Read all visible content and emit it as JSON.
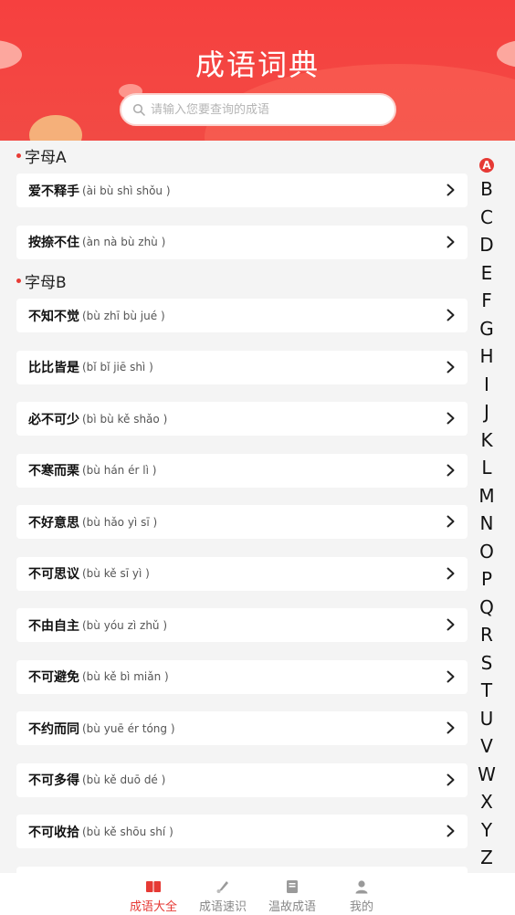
{
  "header": {
    "title": "成语词典",
    "search_placeholder": "请输入您要查询的成语"
  },
  "sections": [
    {
      "title": "字母A",
      "items": [
        {
          "name": "爱不释手",
          "pinyin": "(ài bù shì shǒu )"
        },
        {
          "name": "按捺不住",
          "pinyin": "(àn nà bù zhù )"
        }
      ]
    },
    {
      "title": "字母B",
      "items": [
        {
          "name": "不知不觉",
          "pinyin": "(bù zhī bù jué )"
        },
        {
          "name": "比比皆是",
          "pinyin": "(bǐ bǐ jiē shì )"
        },
        {
          "name": "必不可少",
          "pinyin": "(bì bù kě shǎo )"
        },
        {
          "name": "不寒而栗",
          "pinyin": "(bù hán ér lì )"
        },
        {
          "name": "不好意思",
          "pinyin": "(bù hǎo yì sī )"
        },
        {
          "name": "不可思议",
          "pinyin": "(bù kě sī yì )"
        },
        {
          "name": "不由自主",
          "pinyin": "(bù yóu zì zhǔ )"
        },
        {
          "name": "不可避免",
          "pinyin": "(bù kě bì miǎn )"
        },
        {
          "name": "不约而同",
          "pinyin": "(bù yuē ér tóng )"
        },
        {
          "name": "不可多得",
          "pinyin": "(bù kě duō dé )"
        },
        {
          "name": "不可收拾",
          "pinyin": "(bù kě shōu shí )"
        }
      ]
    }
  ],
  "alphabet": [
    "A",
    "B",
    "C",
    "D",
    "E",
    "F",
    "G",
    "H",
    "I",
    "J",
    "K",
    "L",
    "M",
    "N",
    "O",
    "P",
    "Q",
    "R",
    "S",
    "T",
    "U",
    "V",
    "W",
    "X",
    "Y",
    "Z"
  ],
  "alphabet_active": "A",
  "tabs": [
    {
      "label": "成语大全",
      "icon": "book-icon",
      "active": true
    },
    {
      "label": "成语速识",
      "icon": "brush-icon",
      "active": false
    },
    {
      "label": "温故成语",
      "icon": "notebook-icon",
      "active": false
    },
    {
      "label": "我的",
      "icon": "user-icon",
      "active": false
    }
  ],
  "colors": {
    "accent": "#e63a35",
    "header": "#f6403f",
    "background": "#f4f4f4"
  }
}
